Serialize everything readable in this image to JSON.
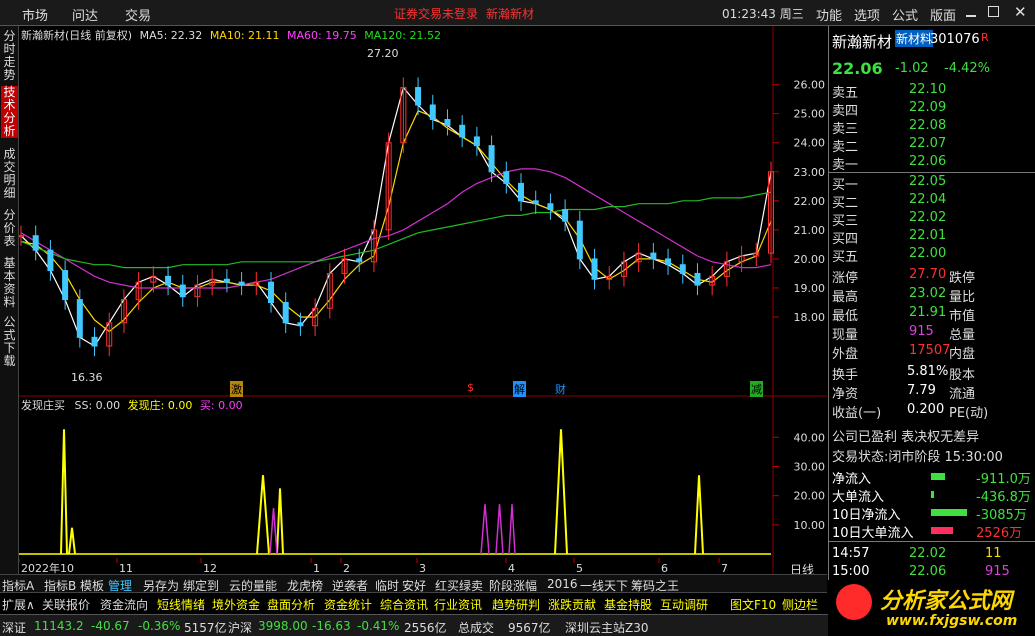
{
  "topbar": {
    "menu_market": "市场",
    "menu_wenda": "问达",
    "menu_trade": "交易",
    "notice": "证券交易未登录",
    "stock_name_red": "新瀚新材",
    "time": "01:23:43 周三",
    "menu_func": "功能",
    "menu_option": "选项",
    "menu_formula": "公式",
    "menu_layout": "版面"
  },
  "sidebar": [
    "分时走势",
    "技术分析",
    "成交明细",
    "分价表",
    "基本资料",
    "公式下载"
  ],
  "main_chart": {
    "title": "新瀚新材(日线 前复权)",
    "ma5": "MA5: 22.32",
    "ma10": "MA10: 21.11",
    "ma60": "MA60: 19.75",
    "ma120": "MA120: 21.52",
    "high_label": "27.20",
    "low_label": "16.36"
  },
  "sub_chart": {
    "title": "发现庄买",
    "ss": "SS: 0.00",
    "fxz": "发现庄: 0.00",
    "mai": "买: 0.00"
  },
  "markers": {
    "ji": "激",
    "s": "$",
    "jie": "解",
    "cai": "财",
    "jian": "减"
  },
  "x_labels": [
    "2022年10",
    "11",
    "12",
    "1",
    "2",
    "3",
    "4",
    "5",
    "6",
    "7"
  ],
  "period": "日线",
  "chart_data": [
    {
      "type": "candlestick",
      "title": "新瀚新材(日线 前复权)",
      "y_ticks": [
        18.0,
        19.0,
        20.0,
        21.0,
        22.0,
        23.0,
        24.0,
        25.0,
        26.0
      ],
      "ylim": [
        15.9,
        27.4
      ],
      "x_labels": [
        "2022年10",
        "11",
        "12",
        "1",
        "2",
        "3",
        "4",
        "5",
        "6",
        "7"
      ],
      "annotations": [
        {
          "text": "27.20"
        },
        {
          "text": "16.36"
        }
      ],
      "series": [
        {
          "name": "MA5",
          "color": "#ffffff",
          "values": [
            20.8,
            20.3,
            19.6,
            18.6,
            17.3,
            17.0,
            17.8,
            18.6,
            19.2,
            19.4,
            19.1,
            18.7,
            19.1,
            19.3,
            19.2,
            19.1,
            19.2,
            18.5,
            17.8,
            17.7,
            18.3,
            19.5,
            20.0,
            19.9,
            21.0,
            24.0,
            25.9,
            25.3,
            24.8,
            24.6,
            24.2,
            23.9,
            23.0,
            22.6,
            22.0,
            21.9,
            21.7,
            21.3,
            20.0,
            19.3,
            19.4,
            19.9,
            20.2,
            20.0,
            19.8,
            19.5,
            19.1,
            19.4,
            19.9,
            20.1,
            20.2,
            23.0
          ]
        },
        {
          "name": "MA10",
          "color": "#ffd700",
          "values": [
            20.6,
            20.5,
            20.1,
            19.5,
            18.6,
            17.9,
            17.5,
            17.9,
            18.5,
            19.0,
            19.2,
            19.0,
            19.0,
            19.2,
            19.2,
            19.1,
            19.1,
            18.9,
            18.4,
            18.0,
            18.0,
            18.6,
            19.3,
            19.8,
            20.1,
            21.8,
            24.0,
            25.1,
            24.9,
            24.5,
            24.2,
            23.9,
            23.3,
            22.7,
            22.2,
            21.9,
            21.7,
            21.4,
            20.7,
            19.7,
            19.3,
            19.6,
            20.0,
            20.0,
            19.9,
            19.6,
            19.3,
            19.2,
            19.6,
            19.9,
            20.1,
            21.3
          ]
        },
        {
          "name": "MA60",
          "color": "#d030d0",
          "values": [
            20.9,
            20.6,
            20.3,
            20.0,
            19.7,
            19.4,
            19.2,
            19.1,
            19.0,
            19.0,
            19.0,
            19.0,
            19.0,
            19.0,
            19.0,
            19.1,
            19.2,
            19.3,
            19.5,
            19.7,
            19.9,
            20.1,
            20.3,
            20.5,
            20.7,
            20.8,
            21.0,
            21.3,
            21.6,
            21.9,
            22.3,
            22.6,
            22.8,
            23.0,
            23.1,
            23.1,
            23.0,
            22.8,
            22.5,
            22.2,
            21.9,
            21.6,
            21.3,
            21.0,
            20.7,
            20.4,
            20.1,
            19.9,
            19.8,
            19.7,
            19.7,
            19.8
          ]
        },
        {
          "name": "MA120",
          "color": "#22bb22",
          "values": [
            20.6,
            20.4,
            20.2,
            20.0,
            19.9,
            19.8,
            19.8,
            19.7,
            19.7,
            19.7,
            19.7,
            19.8,
            19.8,
            19.8,
            19.8,
            19.9,
            19.9,
            19.9,
            19.9,
            19.9,
            19.9,
            20.0,
            20.1,
            20.2,
            20.3,
            20.5,
            20.7,
            20.9,
            21.0,
            21.1,
            21.2,
            21.3,
            21.4,
            21.5,
            21.5,
            21.6,
            21.6,
            21.7,
            21.7,
            21.7,
            21.8,
            21.8,
            21.9,
            21.9,
            21.9,
            22.0,
            22.0,
            22.1,
            22.1,
            22.1,
            22.2,
            22.3
          ]
        }
      ]
    },
    {
      "type": "line",
      "title": "发现庄买",
      "y_ticks": [
        10.0,
        20.0,
        30.0,
        40.0
      ],
      "ylim": [
        0,
        48
      ],
      "series": [
        {
          "name": "SS",
          "color": "#dddddd",
          "values": [
            0
          ]
        },
        {
          "name": "发现庄",
          "color": "#ffff00",
          "values": [
            0,
            0,
            0,
            0,
            0,
            0,
            0,
            0,
            0,
            0,
            0,
            43,
            0,
            0,
            0,
            0,
            0,
            0,
            0,
            0,
            0,
            0,
            0,
            0,
            0,
            0,
            0,
            0,
            0,
            0,
            0,
            0,
            0,
            0,
            0,
            0,
            0,
            0,
            0,
            0,
            0,
            0,
            0,
            0,
            0,
            0,
            0,
            0,
            0,
            0,
            0,
            0
          ]
        },
        {
          "name": "买",
          "color": "#d030d0",
          "values": [
            0
          ]
        }
      ]
    }
  ],
  "right_panel": {
    "name": "新瀚新材",
    "tag": "新材料",
    "code": "301076",
    "r_badge": "R",
    "price": "22.06",
    "change": "-1.02",
    "pct": "-4.42%",
    "asks": [
      {
        "label": "卖五",
        "price": "22.10"
      },
      {
        "label": "卖四",
        "price": "22.09"
      },
      {
        "label": "卖三",
        "price": "22.08"
      },
      {
        "label": "卖二",
        "price": "22.07"
      },
      {
        "label": "卖一",
        "price": "22.06"
      }
    ],
    "bids": [
      {
        "label": "买一",
        "price": "22.05"
      },
      {
        "label": "买二",
        "price": "22.04"
      },
      {
        "label": "买三",
        "price": "22.02"
      },
      {
        "label": "买四",
        "price": "22.01"
      },
      {
        "label": "买五",
        "price": "22.00"
      }
    ],
    "stats": [
      {
        "l1": "涨停",
        "v1": "27.70",
        "c1": "#ff3030",
        "l2": "跌停"
      },
      {
        "l1": "最高",
        "v1": "23.02",
        "c1": "#40e040",
        "l2": "量比"
      },
      {
        "l1": "最低",
        "v1": "21.91",
        "c1": "#40e040",
        "l2": "市值"
      },
      {
        "l1": "现量",
        "v1": "915",
        "c1": "#e040e0",
        "l2": "总量"
      },
      {
        "l1": "外盘",
        "v1": "17507",
        "c1": "#ff3030",
        "l2": "内盘"
      }
    ],
    "stats2": [
      {
        "l1": "换手",
        "v1": "5.81%",
        "c1": "#ffffff",
        "l2": "股本"
      },
      {
        "l1": "净资",
        "v1": "7.79",
        "c1": "#ffffff",
        "l2": "流通"
      },
      {
        "l1": "收益(一)",
        "v1": "0.200",
        "c1": "#ffffff",
        "l2": "PE(动)"
      }
    ],
    "profit_line": "公司已盈利 表决权无差异",
    "trade_status": "交易状态:闭市阶段 15:30:00",
    "flows": [
      {
        "label": "净流入",
        "value": "-911.0万"
      },
      {
        "label": "大单流入",
        "value": "-436.8万"
      },
      {
        "label": "10日净流入",
        "value": "-3085万"
      },
      {
        "label": "10日大单流入",
        "value": "2526万"
      }
    ],
    "ticks": [
      {
        "time": "14:57",
        "price": "22.02",
        "vol": "11"
      },
      {
        "time": "15:00",
        "price": "22.06",
        "vol": "915"
      }
    ]
  },
  "bottom_tabs": [
    "指标A",
    "指标B",
    "模板",
    "管理",
    "另存为",
    "绑定到",
    "云的量能",
    "龙虎榜",
    "逆袭者",
    "临时",
    "安好",
    "红买绿卖",
    "阶段涨幅",
    "2016",
    "一线天下",
    "筹码之王"
  ],
  "feature_tabs": [
    "扩展∧",
    "关联报价",
    "资金流向",
    "短线情绪",
    "境外资金",
    "盘面分析",
    "资金统计",
    "综合资讯",
    "行业资讯",
    "趋势研判",
    "涨跌贡献",
    "基金持股",
    "互动调研",
    "图文F10",
    "侧边栏"
  ],
  "status": {
    "sz_label": "深证",
    "sz_val": "11143.2",
    "sz_chg": "-40.67",
    "sz_pct": "-0.36%",
    "sz_amt": "5157亿",
    "hs_label": "沪深",
    "hs_val": "3998.00",
    "hs_chg": "-16.63",
    "hs_pct": "-0.41%",
    "hs_amt": "2556亿",
    "total_label": "总成交",
    "total": "9567亿",
    "server": "深圳云主站Z30"
  },
  "logo": {
    "name": "分析家公式网",
    "url": "www.fxjgsw.com"
  }
}
